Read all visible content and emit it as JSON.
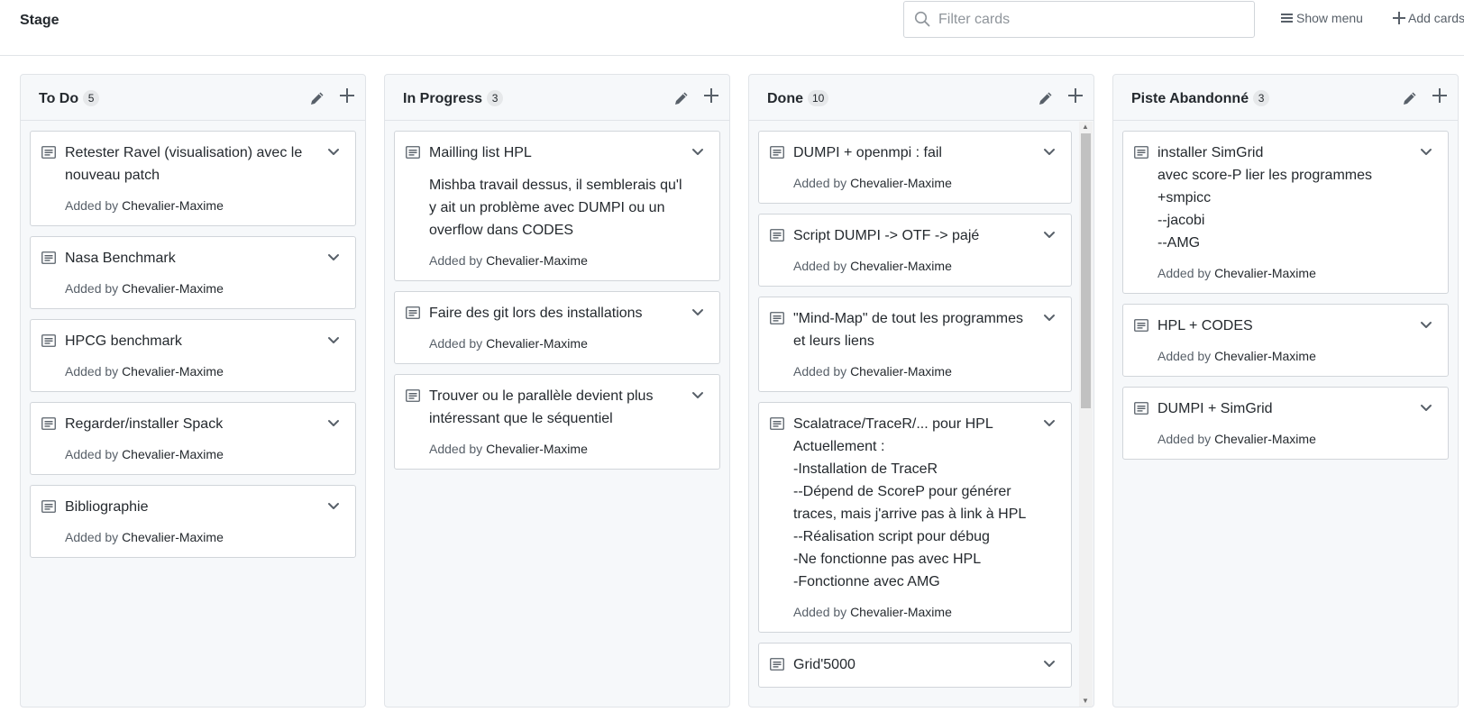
{
  "header": {
    "title": "Stage",
    "filter_placeholder": "Filter cards",
    "show_menu_label": "Show menu",
    "add_cards_label": "Add cards"
  },
  "columns": [
    {
      "name": "To Do",
      "count": "5",
      "cards": [
        {
          "title": "Retester Ravel (visualisation) avec le nouveau patch",
          "added_by_label": "Added by",
          "author": "Chevalier-Maxime"
        },
        {
          "title": "Nasa Benchmark",
          "added_by_label": "Added by",
          "author": "Chevalier-Maxime"
        },
        {
          "title": "HPCG benchmark",
          "added_by_label": "Added by",
          "author": "Chevalier-Maxime"
        },
        {
          "title": "Regarder/installer Spack",
          "added_by_label": "Added by",
          "author": "Chevalier-Maxime"
        },
        {
          "title": "Bibliographie",
          "added_by_label": "Added by",
          "author": "Chevalier-Maxime"
        }
      ]
    },
    {
      "name": "In Progress",
      "count": "3",
      "cards": [
        {
          "title": "Mailling list HPL",
          "body": "Mishba travail dessus, il semblerais qu'l y ait un problème avec DUMPI ou un overflow dans CODES",
          "added_by_label": "Added by",
          "author": "Chevalier-Maxime"
        },
        {
          "title": "Faire des git lors des installations",
          "added_by_label": "Added by",
          "author": "Chevalier-Maxime"
        },
        {
          "title": "Trouver ou le parallèle devient plus intéressant que le séquentiel",
          "added_by_label": "Added by",
          "author": "Chevalier-Maxime"
        }
      ]
    },
    {
      "name": "Done",
      "count": "10",
      "cards": [
        {
          "title": "DUMPI + openmpi : fail",
          "added_by_label": "Added by",
          "author": "Chevalier-Maxime"
        },
        {
          "title": "Script DUMPI -> OTF -> pajé",
          "added_by_label": "Added by",
          "author": "Chevalier-Maxime"
        },
        {
          "title": "\"Mind-Map\" de tout les programmes et leurs liens",
          "added_by_label": "Added by",
          "author": "Chevalier-Maxime"
        },
        {
          "title": "Scalatrace/TraceR/... pour HPL\nActuellement :\n-Installation de TraceR\n--Dépend de ScoreP pour générer traces, mais j'arrive pas à link à HPL\n--Réalisation script pour débug\n-Ne fonctionne pas avec HPL\n-Fonctionne avec AMG",
          "added_by_label": "Added by",
          "author": "Chevalier-Maxime"
        },
        {
          "title": "Grid'5000",
          "added_by_label": "",
          "author": ""
        }
      ]
    },
    {
      "name": "Piste Abandonné",
      "count": "3",
      "cards": [
        {
          "title": "installer SimGrid\navec score-P lier les programmes\n+smpicc\n--jacobi\n--AMG",
          "added_by_label": "Added by",
          "author": "Chevalier-Maxime"
        },
        {
          "title": "HPL + CODES",
          "added_by_label": "Added by",
          "author": "Chevalier-Maxime"
        },
        {
          "title": "DUMPI + SimGrid",
          "added_by_label": "Added by",
          "author": "Chevalier-Maxime"
        }
      ]
    }
  ],
  "icons": {
    "filter": "search-icon",
    "menu": "hamburger-icon",
    "add": "plus-icon",
    "edit": "pencil-icon",
    "card": "note-icon",
    "expand": "chevron-down-icon"
  },
  "colors": {
    "text": "#24292e",
    "muted": "#586069",
    "column_bg": "#f6f8fa",
    "border": "#d1d5da"
  }
}
